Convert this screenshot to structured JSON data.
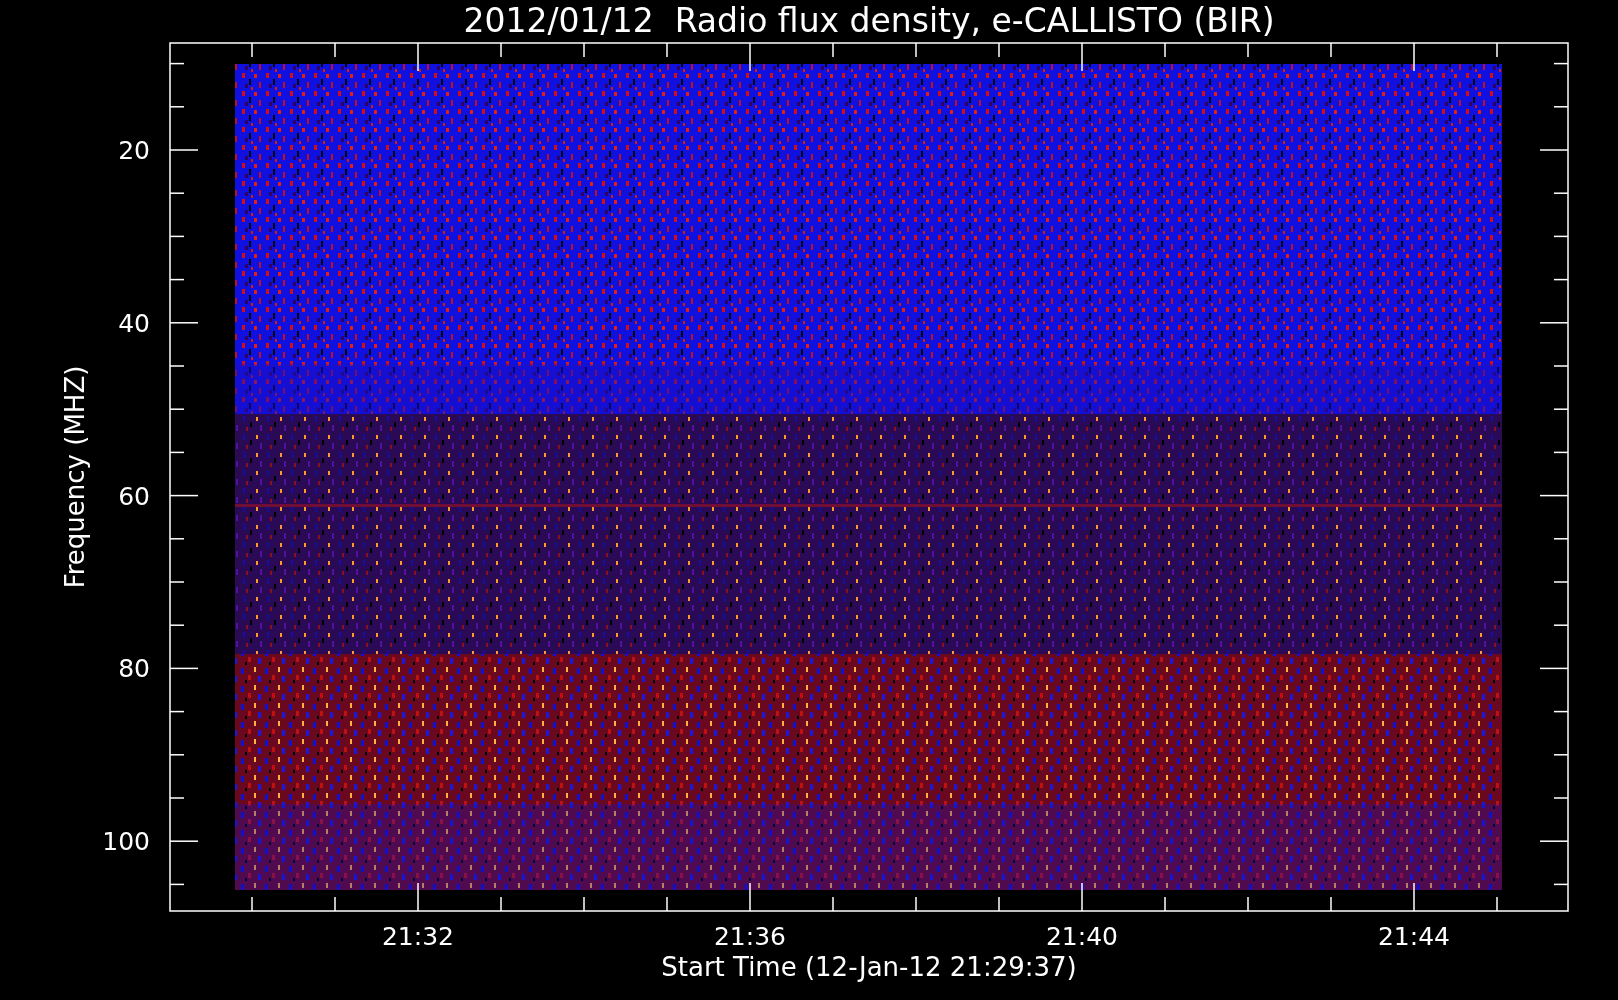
{
  "title": "2012/01/12  Radio flux density, e-CALLISTO (BIR)",
  "ylabel": "Frequency (MHZ)",
  "xlabel": "Start Time (12-Jan-12 21:29:37)",
  "yticks": [
    "20",
    "40",
    "60",
    "80",
    "100"
  ],
  "xticks": [
    "21:32",
    "21:36",
    "21:40",
    "21:44"
  ]
}
